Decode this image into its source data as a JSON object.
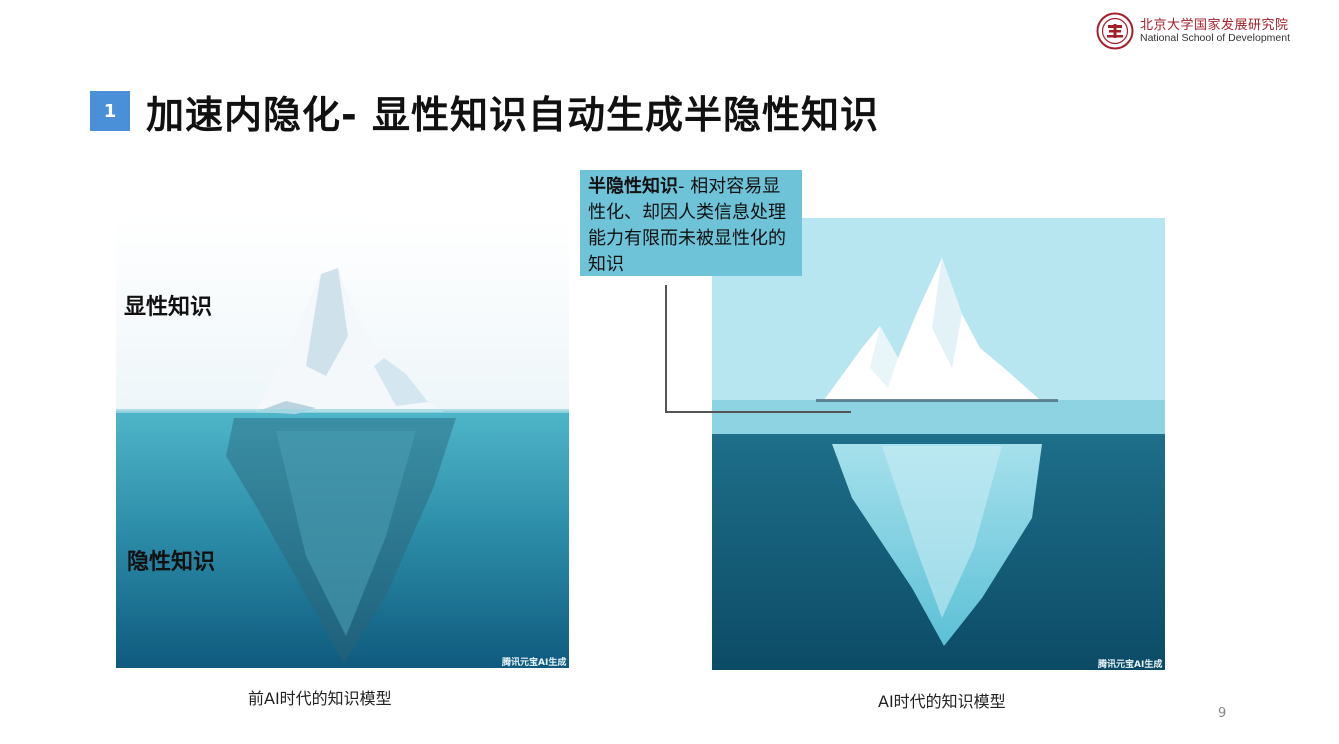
{
  "logo": {
    "name_cn": "北京大学国家发展研究院",
    "name_en": "National School of Development",
    "brand_color": "#a3202a",
    "icon": "pku-seal-icon"
  },
  "section_number": "1",
  "title": "加速内隐化- 显性知识自动生成半隐性知识",
  "left_figure": {
    "label_top": "显性知识",
    "label_bottom": "隐性知识",
    "watermark": "腾讯元宝AI生成",
    "caption": "前AI时代的知识模型"
  },
  "right_figure": {
    "watermark": "腾讯元宝AI生成",
    "caption": "AI时代的知识模型"
  },
  "callout": {
    "heading": "半隐性知识",
    "body": "- 相对容易显性化、却因人类信息处理能力有限而未被显性化的知识",
    "color": "#6fc3d8"
  },
  "page_number": "9",
  "colors": {
    "badge": "#4a90d9"
  }
}
